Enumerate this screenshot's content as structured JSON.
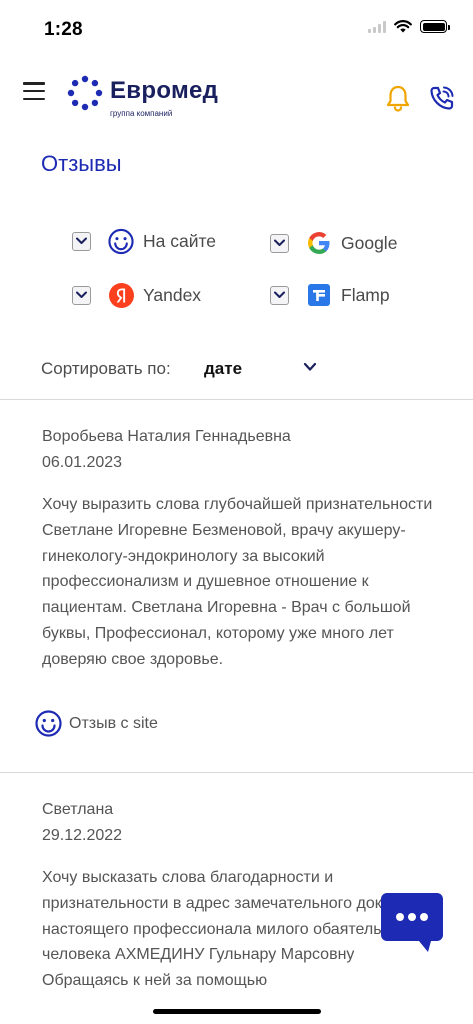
{
  "status_bar": {
    "time": "1:28"
  },
  "header": {
    "logo_name": "Евромед",
    "logo_subtitle": "группа компаний",
    "brand_color": "#1a1f5e",
    "bell_color": "#f0a500",
    "phone_color": "#1d2ab3"
  },
  "page": {
    "title": "Отзывы"
  },
  "filters": [
    {
      "label": "На сайте",
      "icon": "smiley-icon",
      "checked": true
    },
    {
      "label": "Google",
      "icon": "google-icon",
      "checked": true
    },
    {
      "label": "Yandex",
      "icon": "yandex-icon",
      "checked": true
    },
    {
      "label": "Flamp",
      "icon": "flamp-icon",
      "checked": true
    }
  ],
  "sort": {
    "label": "Сортировать по:",
    "value": "дате"
  },
  "reviews": [
    {
      "author": "Воробьева Наталия Геннадьевна",
      "date": "06.01.2023",
      "text": "Хочу выразить слова глубочайшей признательности Светлане Игоревне Безменовой, врачу акушеру-гинекологу-эндокринологу за высокий профессионализм и душевное отношение к пациентам.  Светлана Игоревна - Врач с большой буквы, Профессионал, которому уже много лет доверяю свое здоровье.",
      "source": "Отзыв с site"
    },
    {
      "author": "Светлана",
      "date": "29.12.2022",
      "text": "Хочу высказать слова благодарности и признательности в адрес замечательного доктора настоящего профессионала милого обаятельного человека АХМЕДИНУ Гульнару Марсовну Обращаясь к ней за помощью"
    }
  ],
  "chat": {
    "icon": "chat-icon",
    "color": "#1d2ab3"
  }
}
